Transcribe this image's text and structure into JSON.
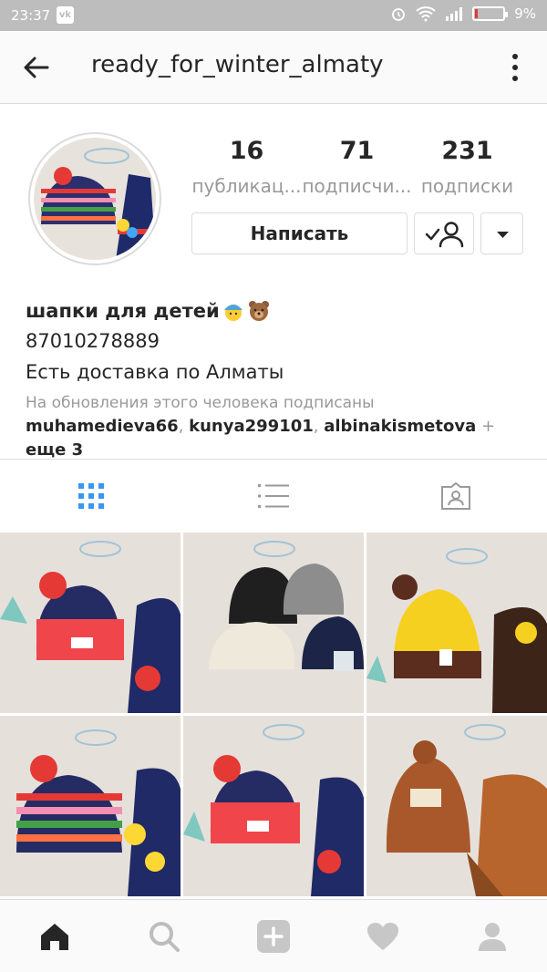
{
  "status_bar": {
    "time": "23:37",
    "battery": "9%",
    "battery_level": 0.09
  },
  "header": {
    "title": "ready_for_winter_almaty"
  },
  "stats": [
    {
      "value": "16",
      "label": "публикац..."
    },
    {
      "value": "71",
      "label": "подписчи..."
    },
    {
      "value": "231",
      "label": "подписки"
    }
  ],
  "actions": {
    "message_label": "Написать"
  },
  "bio": {
    "name": "шапки для детей",
    "phone": "87010278889",
    "delivery": "Есть доставка по Алматы",
    "followed_by_label": "На обновления этого человека подписаны",
    "followers": [
      "muhamedieva66",
      "kunya299101",
      "albinakismetova"
    ],
    "more": "еще 3"
  },
  "colors": {
    "accent": "#3897f0",
    "muted": "#999999",
    "text": "#262626"
  },
  "icons": {
    "tabs": [
      "grid-icon",
      "list-icon",
      "tagged-icon"
    ],
    "nav": [
      "home-icon",
      "search-icon",
      "add-icon",
      "heart-icon",
      "profile-icon"
    ]
  }
}
